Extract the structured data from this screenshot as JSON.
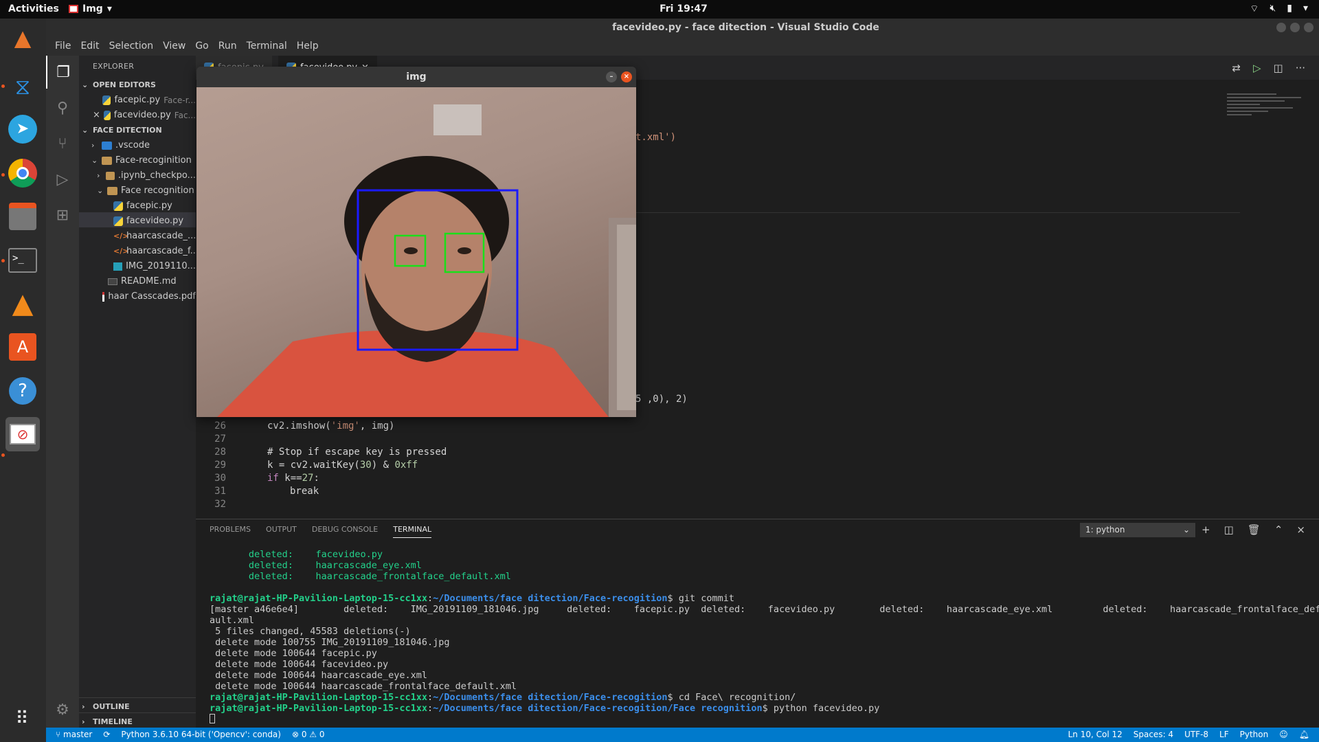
{
  "topbar": {
    "activities": "Activities",
    "app_name": "Img",
    "clock": "Fri 19:47"
  },
  "window": {
    "title": "facevideo.py - face ditection - Visual Studio Code"
  },
  "menu": [
    "File",
    "Edit",
    "Selection",
    "View",
    "Go",
    "Run",
    "Terminal",
    "Help"
  ],
  "explorer": {
    "header": "EXPLORER",
    "open_editors_label": "OPEN EDITORS",
    "open_editors": [
      {
        "name": "facepic.py",
        "path": "Face-r..."
      },
      {
        "name": "facevideo.py",
        "path": "Fac..."
      }
    ],
    "folder_label": "FACE DITECTION",
    "tree": [
      ".vscode",
      "Face-recoginition",
      ".ipynb_checkpo...",
      "Face recognition",
      "facepic.py",
      "facevideo.py",
      "haarcascade_...",
      "haarcascade_f...",
      "IMG_2019110...",
      "README.md",
      "haar Casscades.pdf"
    ],
    "outline_label": "OUTLINE",
    "timeline_label": "TIMELINE"
  },
  "tabs": [
    "facepic.py",
    "facevideo.py"
  ],
  "editor": {
    "fragment_top": "t.xml')",
    "fragment_mid": "5 ,0), 2)",
    "lines": [
      {
        "n": "26",
        "code": "cv2.imshow('img', img)"
      },
      {
        "n": "27",
        "code": ""
      },
      {
        "n": "28",
        "code": "# Stop if escape key is pressed"
      },
      {
        "n": "29",
        "code": "k = cv2.waitKey(30) & 0xff"
      },
      {
        "n": "30",
        "code": "if k==27:"
      },
      {
        "n": "31",
        "code": "break"
      },
      {
        "n": "32",
        "code": ""
      }
    ]
  },
  "panel": {
    "tabs": [
      "PROBLEMS",
      "OUTPUT",
      "DEBUG CONSOLE",
      "TERMINAL"
    ],
    "terminal_select": "1: python",
    "terminal": {
      "deleted_label": "deleted:",
      "deleted_files": [
        "facevideo.py",
        "haarcascade_eye.xml",
        "haarcascade_frontalface_default.xml"
      ],
      "prompt_user": "rajat@rajat-HP-Pavilion-Laptop-15-cc1xx",
      "path1": "~/Documents/face ditection/Face-recogition",
      "cmd1": "$ git commit",
      "commit_line": "[master a46e6e4]        deleted:    IMG_20191109_181046.jpg     deleted:    facepic.py  deleted:    facevideo.py        deleted:    haarcascade_eye.xml         deleted:    haarcascade_frontalface_def",
      "commit_line_wrap": "ault.xml",
      "summary": " 5 files changed, 45583 deletions(-)",
      "modes": [
        " delete mode 100755 IMG_20191109_181046.jpg",
        " delete mode 100644 facepic.py",
        " delete mode 100644 facevideo.py",
        " delete mode 100644 haarcascade_eye.xml",
        " delete mode 100644 haarcascade_frontalface_default.xml"
      ],
      "cmd2": "$ cd Face\\ recognition/",
      "path2": "~/Documents/face ditection/Face-recogition/Face recognition",
      "cmd3": "$ python facevideo.py"
    }
  },
  "statusbar": {
    "branch": "master",
    "interpreter": "Python 3.6.10 64-bit ('Opencv': conda)",
    "problems": "⊗ 0 ⚠ 0",
    "position": "Ln 10, Col 12",
    "spaces": "Spaces: 4",
    "encoding": "UTF-8",
    "eol": "LF",
    "language": "Python"
  },
  "cv_window": {
    "title": "img"
  },
  "colors": {
    "face_box": "#1a1aff",
    "eye_box": "#19e019",
    "statusbar": "#007acc"
  }
}
